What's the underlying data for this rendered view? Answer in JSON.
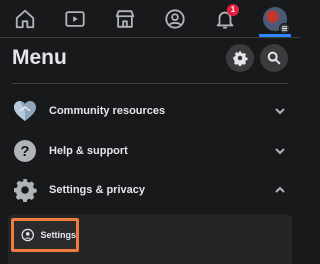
{
  "nav": {
    "tabs": [
      {
        "name": "home",
        "icon": "home-icon"
      },
      {
        "name": "watch",
        "icon": "video-icon"
      },
      {
        "name": "marketplace",
        "icon": "store-icon"
      },
      {
        "name": "profile",
        "icon": "profile-icon"
      },
      {
        "name": "notifications",
        "icon": "bell-icon",
        "badge": "1"
      },
      {
        "name": "menu",
        "icon": "avatar-icon",
        "active": true
      }
    ]
  },
  "menu": {
    "title": "Menu",
    "settings_icon": "gear-icon",
    "search_icon": "search-icon"
  },
  "rows": [
    {
      "label": "Community resources",
      "icon": "community-heart-icon",
      "chevron": "chevron-down-icon"
    },
    {
      "label": "Help & support",
      "icon": "question-icon",
      "chevron": "chevron-down-icon"
    },
    {
      "label": "Settings & privacy",
      "icon": "gear-icon",
      "chevron": "chevron-up-icon"
    }
  ],
  "submenu": {
    "settings_label": "Settings",
    "settings_icon": "account-circle-icon"
  },
  "colors": {
    "background": "#18191a",
    "surface": "#242526",
    "accent": "#2d88ff",
    "badge": "#e41e3f",
    "highlight": "#f07b3f"
  }
}
